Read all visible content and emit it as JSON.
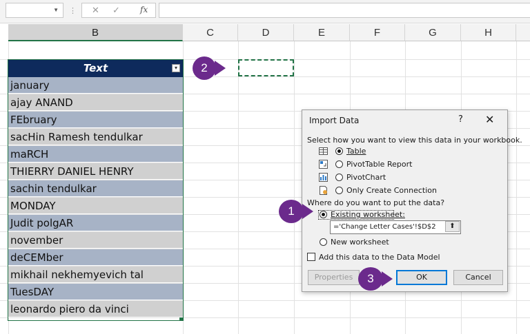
{
  "formula_bar": {
    "fx_label": "fx",
    "cancel_glyph": "✕",
    "enter_glyph": "✓",
    "namebox_dropdown": "▼",
    "separator": "⋮"
  },
  "columns": [
    "B",
    "C",
    "D",
    "E",
    "F",
    "G",
    "H"
  ],
  "table": {
    "header": "Text",
    "filter_glyph": "▾",
    "rows": [
      "january",
      "ajay ANAND",
      "FEbruary",
      "sacHin Ramesh tendulkar",
      "maRCH",
      "THIERRY DANIEL HENRY",
      "sachin tendulkar",
      "MONDAY",
      "Judit polgAR",
      "november",
      "deCEMber",
      "mikhail nekhemyevich tal",
      "TuesDAY",
      "leonardo piero da vinci"
    ]
  },
  "badges": {
    "one": "1",
    "two": "2",
    "three": "3"
  },
  "dialog": {
    "title": "Import Data",
    "help": "?",
    "close": "✕",
    "view_prompt": "Select how you want to view this data in your workbook.",
    "view_options": [
      {
        "label": "Table",
        "selected": true,
        "icon": "table-icon"
      },
      {
        "label": "PivotTable Report",
        "selected": false,
        "icon": "pivottable-icon"
      },
      {
        "label": "PivotChart",
        "selected": false,
        "icon": "pivotchart-icon"
      },
      {
        "label": "Only Create Connection",
        "selected": false,
        "icon": "connection-icon"
      }
    ],
    "put_prompt": "Where do you want to put the data?",
    "existing_label": "Existing worksheet:",
    "reference_value": "='Change Letter Cases'!$D$2",
    "reference_button": "⬆",
    "new_label": "New worksheet",
    "data_model_label": "Add this data to the Data Model",
    "properties_label": "Properties",
    "ok_label": "OK",
    "cancel_label": "Cancel"
  },
  "colors": {
    "table_header": "#0e2a5c",
    "row_odd": "#a7b3c6",
    "row_even": "#d0d0d0",
    "badge": "#6b2a8c",
    "excel_green": "#217346"
  }
}
